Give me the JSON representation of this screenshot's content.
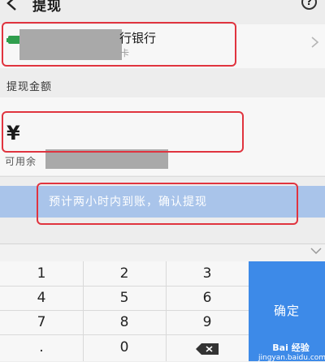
{
  "header": {
    "title": "提现",
    "help_symbol": "?"
  },
  "bank": {
    "name": "行银行",
    "sub": "卡"
  },
  "amount": {
    "label": "提现金额",
    "currency_symbol": "¥",
    "available_prefix": "可用余"
  },
  "confirm": {
    "label": "预计两小时内到账，确认提现"
  },
  "keyboard": {
    "keys": [
      "1",
      "2",
      "3",
      "4",
      "5",
      "6",
      "7",
      "8",
      "9",
      ".",
      "0"
    ],
    "ok_label": "确定"
  },
  "watermark": {
    "line1": "Bai 经验",
    "line2": "jingyan.baidu.com"
  },
  "colors": {
    "accent": "#3d8ae8",
    "button_disabled": "#a9c4ea",
    "annotation": "#e0343f"
  }
}
